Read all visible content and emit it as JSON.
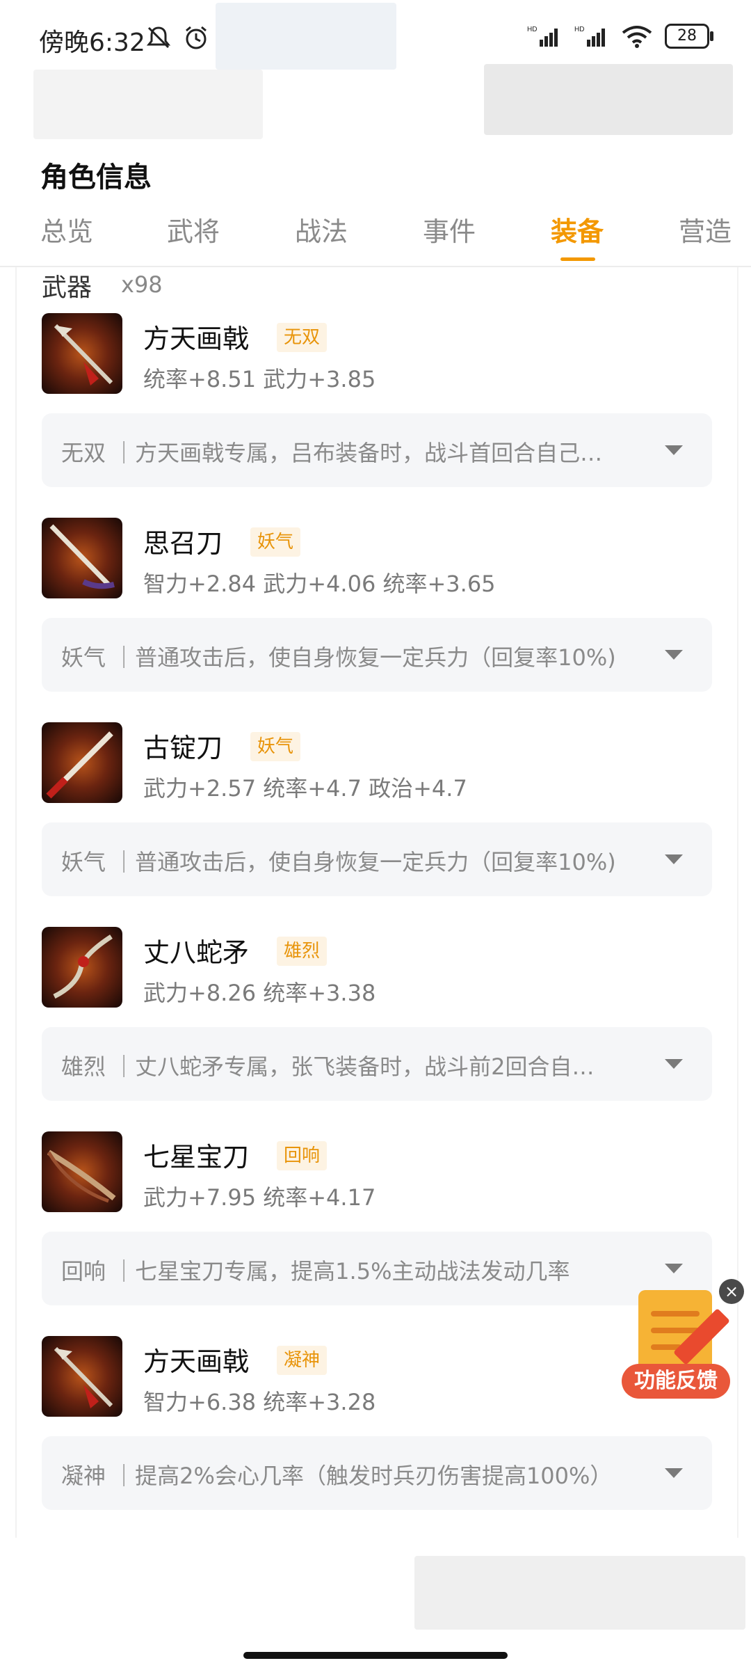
{
  "status_bar": {
    "time": "傍晚6:32",
    "battery": "28",
    "signal_label_1": "HD",
    "signal_label_2": "HD"
  },
  "header": {
    "title": "角色信息"
  },
  "tabs": [
    {
      "label": "总览"
    },
    {
      "label": "武将"
    },
    {
      "label": "战法"
    },
    {
      "label": "事件"
    },
    {
      "label": "装备",
      "active": true
    },
    {
      "label": "营造"
    }
  ],
  "section": {
    "title": "武器",
    "count": "x98"
  },
  "items": [
    {
      "name": "方天画戟",
      "tag": "无双",
      "stats": "统率+8.51 武力+3.85",
      "skill": "无双 ｜方天画戟专属，吕布装备时，战斗首回合自己…"
    },
    {
      "name": "思召刀",
      "tag": "妖气",
      "stats": "智力+2.84 武力+4.06 统率+3.65",
      "skill": "妖气 ｜普通攻击后，使自身恢复一定兵力（回复率10%)"
    },
    {
      "name": "古锭刀",
      "tag": "妖气",
      "stats": "武力+2.57 统率+4.7 政治+4.7",
      "skill": "妖气 ｜普通攻击后，使自身恢复一定兵力（回复率10%)"
    },
    {
      "name": "丈八蛇矛",
      "tag": "雄烈",
      "stats": "武力+8.26 统率+3.38",
      "skill": "雄烈 ｜丈八蛇矛专属，张飞装备时，战斗前2回合自…"
    },
    {
      "name": "七星宝刀",
      "tag": "回响",
      "stats": "武力+7.95 统率+4.17",
      "skill": "回响 ｜七星宝刀专属，提高1.5%主动战法发动几率"
    },
    {
      "name": "方天画戟",
      "tag": "凝神",
      "stats": "智力+6.38 统率+3.28",
      "skill": "凝神 ｜提高2%会心几率（触发时兵刃伤害提高100%）"
    }
  ],
  "feedback": {
    "label": "功能反馈",
    "close": "×"
  },
  "colors": {
    "accent": "#f39800",
    "tag_bg": "#fdf3e3",
    "skill_bg": "#f5f6f8"
  }
}
